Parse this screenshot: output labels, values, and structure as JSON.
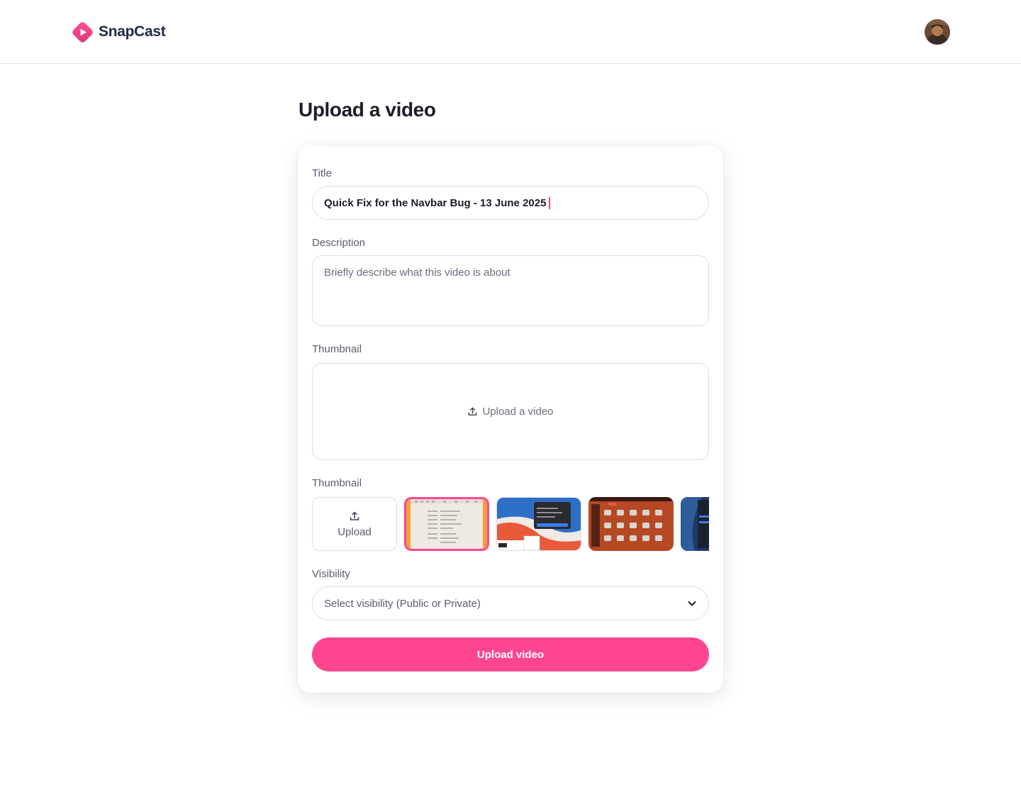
{
  "brand": {
    "name": "SnapCast",
    "accent": "#ff4590"
  },
  "header": {
    "avatar_icon": "user-avatar"
  },
  "page": {
    "title": "Upload a video"
  },
  "form": {
    "title_label": "Title",
    "title_value": "Quick Fix for the Navbar Bug - 13 June 2025",
    "description_label": "Description",
    "description_placeholder": "Briefly describe what this video is about",
    "video_label": "Thumbnail",
    "video_upload_text": "Upload a video",
    "thumbnail_label": "Thumbnail",
    "thumbnail_upload_text": "Upload",
    "thumbnail_selected_index": 0,
    "visibility_label": "Visibility",
    "visibility_placeholder": "Select visibility (Public or Private)",
    "submit_label": "Upload video"
  }
}
